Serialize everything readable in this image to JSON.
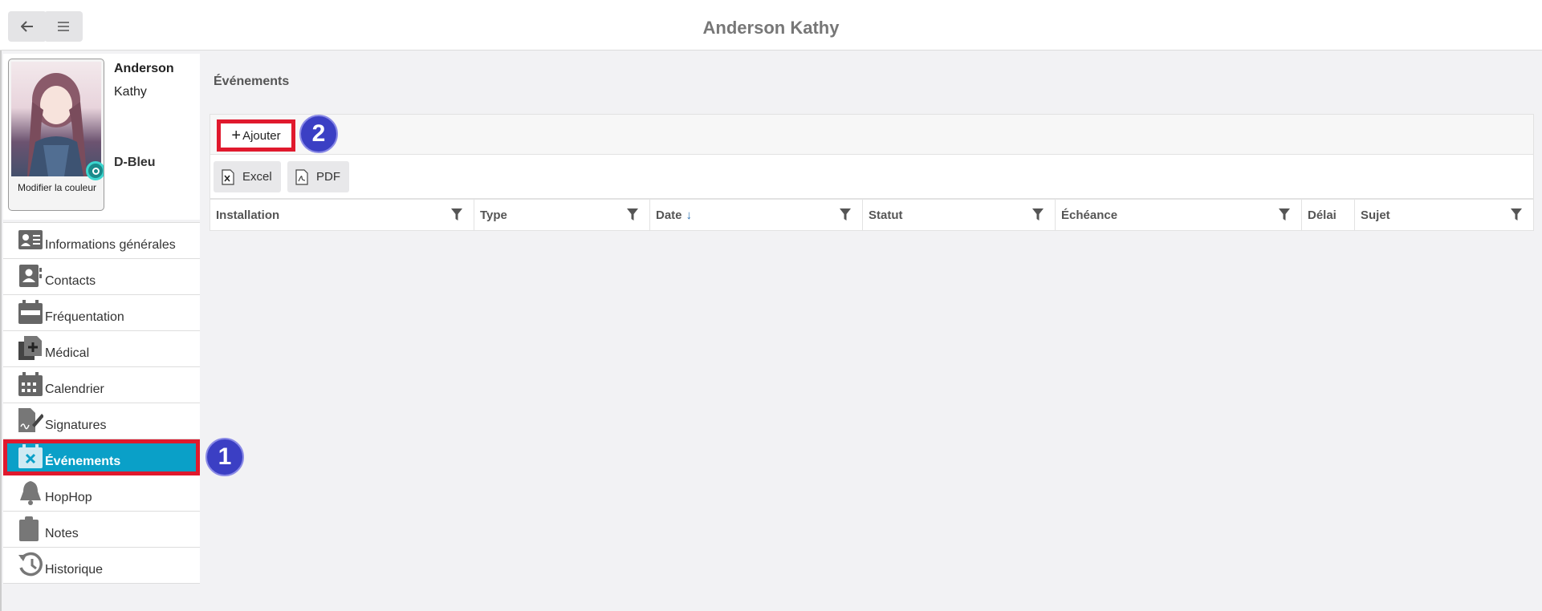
{
  "header": {
    "title": "Anderson Kathy"
  },
  "profile": {
    "last_name": "Anderson",
    "first_name": "Kathy",
    "group": "D-Bleu",
    "photo_caption": "Modifier la couleur"
  },
  "sidebar": {
    "items": [
      {
        "label": "Informations générales",
        "icon": "id-card-icon"
      },
      {
        "label": "Contacts",
        "icon": "contacts-icon"
      },
      {
        "label": "Fréquentation",
        "icon": "attendance-calendar-icon"
      },
      {
        "label": "Médical",
        "icon": "medical-icon"
      },
      {
        "label": "Calendrier",
        "icon": "calendar-icon"
      },
      {
        "label": "Signatures",
        "icon": "signature-icon"
      },
      {
        "label": "Événements",
        "icon": "event-icon",
        "active": true
      },
      {
        "label": "HopHop",
        "icon": "bell-icon"
      },
      {
        "label": "Notes",
        "icon": "clipboard-icon"
      },
      {
        "label": "Historique",
        "icon": "history-icon"
      }
    ]
  },
  "main": {
    "section_title": "Événements",
    "add_label": "Ajouter",
    "export": {
      "excel_label": "Excel",
      "pdf_label": "PDF"
    },
    "columns": [
      {
        "label": "Installation",
        "filter": true
      },
      {
        "label": "Type",
        "filter": true
      },
      {
        "label": "Date",
        "filter": true,
        "sorted": "desc"
      },
      {
        "label": "Statut",
        "filter": true
      },
      {
        "label": "Échéance",
        "filter": true
      },
      {
        "label": "Délai",
        "filter": false
      },
      {
        "label": "Sujet",
        "filter": true
      }
    ]
  },
  "markers": [
    "1",
    "2"
  ],
  "colors": {
    "active": "#0aa0c8",
    "highlight": "#e0192d",
    "marker": "#3b3fc4"
  }
}
